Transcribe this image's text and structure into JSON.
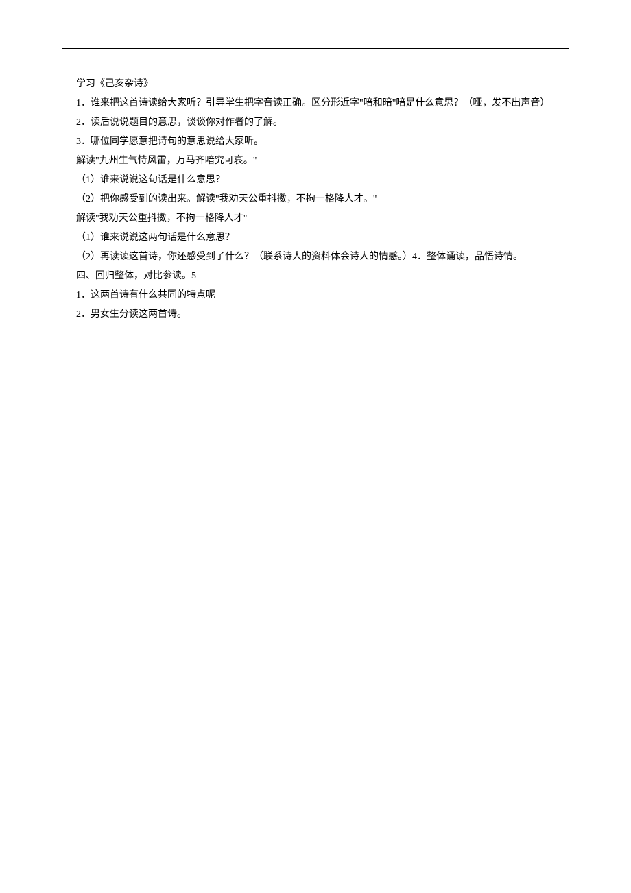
{
  "lines": [
    {
      "text": "学习《己亥杂诗》",
      "indent": true
    },
    {
      "text": "1．谁来把这首诗读给大家听？引导学生把字音读正确。区分形近字\"喑和暗\"喑是什么意思？（哑，发不出声音）",
      "indent": true
    },
    {
      "text": "2．读后说说题目的意思，谈谈你对作者的了解。",
      "indent": true
    },
    {
      "text": "3．哪位同学愿意把诗句的意思说给大家听。",
      "indent": true
    },
    {
      "text": "解读\"九州生气恃风雷，万马齐喑究可哀。\"",
      "indent": true
    },
    {
      "text": "（1）谁来说说这句话是什么意思？",
      "indent": true
    },
    {
      "text": "（2）把你感受到的读出来。解读\"我劝天公重抖擞，不拘一格降人才。\"",
      "indent": true
    },
    {
      "text": "解读\"我劝天公重抖擞，不拘一格降人才\"",
      "indent": true
    },
    {
      "text": "（1）谁来说说这两句话是什么意思？",
      "indent": true
    },
    {
      "text": "（2）再读读这首诗，你还感受到了什么？（联系诗人的资料体会诗人的情感。）4．整体诵读，品悟诗情。",
      "indent": true
    },
    {
      "text": "四、回归整体，对比参读。5",
      "indent": true
    },
    {
      "text": "1．这两首诗有什么共同的特点呢",
      "indent": true
    },
    {
      "text": "2．男女生分读这两首诗。",
      "indent": true
    }
  ]
}
